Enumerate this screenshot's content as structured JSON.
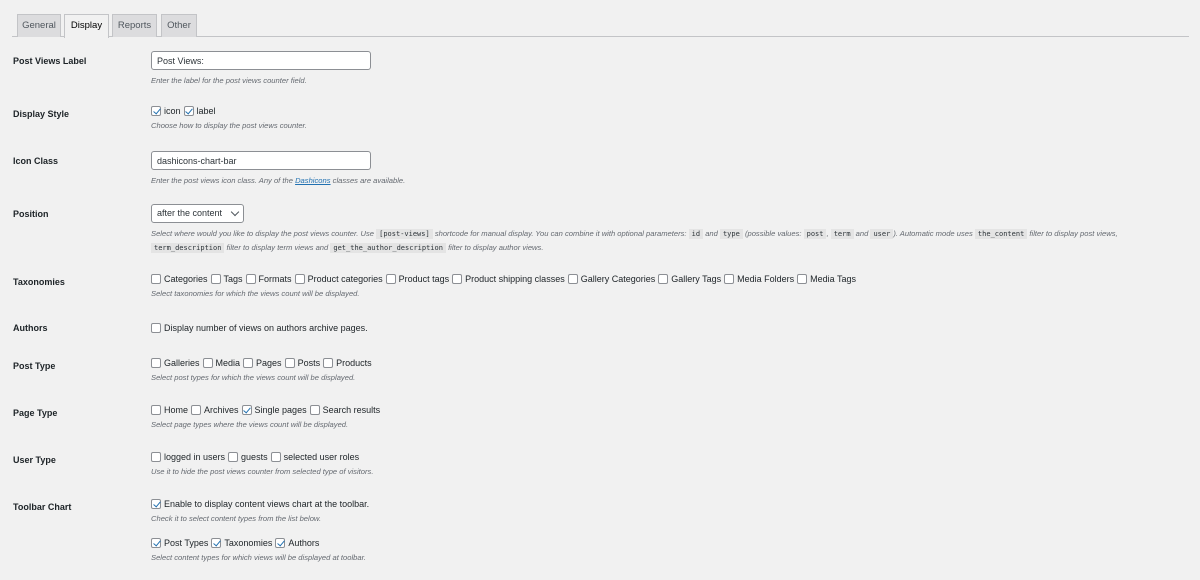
{
  "tabs": [
    {
      "label": "General",
      "active": false
    },
    {
      "label": "Display",
      "active": true
    },
    {
      "label": "Reports",
      "active": false
    },
    {
      "label": "Other",
      "active": false
    }
  ],
  "post_views_label": {
    "label": "Post Views Label",
    "value": "Post Views:",
    "desc": "Enter the label for the post views counter field."
  },
  "display_style": {
    "label": "Display Style",
    "options": [
      {
        "label": "icon",
        "checked": true
      },
      {
        "label": "label",
        "checked": true
      }
    ],
    "desc": "Choose how to display the post views counter."
  },
  "icon_class": {
    "label": "Icon Class",
    "value": "dashicons-chart-bar",
    "desc_before": "Enter the post views icon class. Any of the ",
    "desc_link": "Dashicons",
    "desc_after": " classes are available."
  },
  "position": {
    "label": "Position",
    "selected": "after the content",
    "desc_parts": [
      {
        "t": "Select where would you like to display the post views counter. Use "
      },
      {
        "c": "[post-views]"
      },
      {
        "t": " shortcode for manual display. You can combine it with optional parameters: "
      },
      {
        "c": "id"
      },
      {
        "t": " and "
      },
      {
        "c": "type"
      },
      {
        "t": " (possible values: "
      },
      {
        "c": "post"
      },
      {
        "t": ", "
      },
      {
        "c": "term"
      },
      {
        "t": " and "
      },
      {
        "c": "user"
      },
      {
        "t": "). Automatic mode uses "
      },
      {
        "c": "the_content"
      },
      {
        "t": " filter to display post views, "
      },
      {
        "c": "term_description"
      },
      {
        "t": " filter to display term views and "
      },
      {
        "c": "get_the_author_description"
      },
      {
        "t": " filter to display author views."
      }
    ]
  },
  "taxonomies": {
    "label": "Taxonomies",
    "options": [
      {
        "label": "Categories",
        "checked": false
      },
      {
        "label": "Tags",
        "checked": false
      },
      {
        "label": "Formats",
        "checked": false
      },
      {
        "label": "Product categories",
        "checked": false
      },
      {
        "label": "Product tags",
        "checked": false
      },
      {
        "label": "Product shipping classes",
        "checked": false
      },
      {
        "label": "Gallery Categories",
        "checked": false
      },
      {
        "label": "Gallery Tags",
        "checked": false
      },
      {
        "label": "Media Folders",
        "checked": false
      },
      {
        "label": "Media Tags",
        "checked": false
      }
    ],
    "desc": "Select taxonomies for which the views count will be displayed."
  },
  "authors": {
    "label": "Authors",
    "options": [
      {
        "label": "Display number of views on authors archive pages.",
        "checked": false
      }
    ]
  },
  "post_type": {
    "label": "Post Type",
    "options": [
      {
        "label": "Galleries",
        "checked": false
      },
      {
        "label": "Media",
        "checked": false
      },
      {
        "label": "Pages",
        "checked": false
      },
      {
        "label": "Posts",
        "checked": false
      },
      {
        "label": "Products",
        "checked": false
      }
    ],
    "desc": "Select post types for which the views count will be displayed."
  },
  "page_type": {
    "label": "Page Type",
    "options": [
      {
        "label": "Home",
        "checked": false
      },
      {
        "label": "Archives",
        "checked": false
      },
      {
        "label": "Single pages",
        "checked": true
      },
      {
        "label": "Search results",
        "checked": false
      }
    ],
    "desc": "Select page types where the views count will be displayed."
  },
  "user_type": {
    "label": "User Type",
    "options": [
      {
        "label": "logged in users",
        "checked": false
      },
      {
        "label": "guests",
        "checked": false
      },
      {
        "label": "selected user roles",
        "checked": false
      }
    ],
    "desc": "Use it to hide the post views counter from selected type of visitors."
  },
  "toolbar_chart": {
    "label": "Toolbar Chart",
    "options": [
      {
        "label": "Enable to display content views chart at the toolbar.",
        "checked": true
      }
    ],
    "desc": "Check it to select content types from the list below.",
    "sub_options": [
      {
        "label": "Post Types",
        "checked": true
      },
      {
        "label": "Taxonomies",
        "checked": true
      },
      {
        "label": "Authors",
        "checked": true
      }
    ],
    "sub_desc": "Select content types for which views will be displayed at toolbar."
  }
}
